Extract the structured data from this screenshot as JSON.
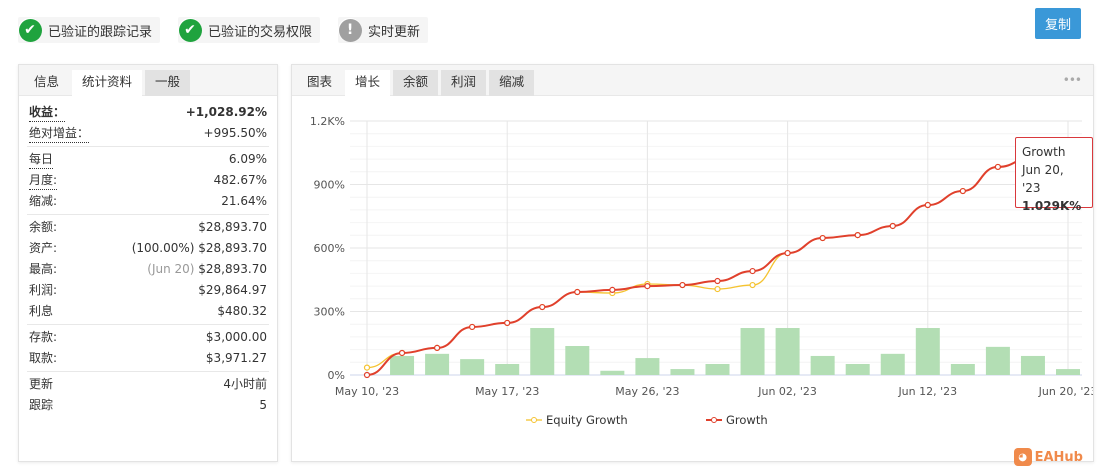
{
  "badges": [
    {
      "label": "已验证的跟踪记录",
      "icon": "check-icon",
      "color": "#1fa33e"
    },
    {
      "label": "已验证的交易权限",
      "icon": "check-icon",
      "color": "#1fa33e"
    },
    {
      "label": "实时更新",
      "icon": "exclamation-icon",
      "color": "#a0a0a0"
    }
  ],
  "copy_label": "复制",
  "left_tabs": [
    "信息",
    "统计资料",
    "一般"
  ],
  "stats": [
    [
      {
        "k": "收益：",
        "v": "+1,028.92%",
        "cls": "green bold",
        "kcls": "dot bold"
      },
      {
        "k": "绝对增益：",
        "v": "+995.50%",
        "cls": "green",
        "kcls": "dot"
      }
    ],
    [
      {
        "k": "每日",
        "v": "6.09%",
        "kcls": "dot"
      },
      {
        "k": "月度:",
        "v": "482.67%",
        "kcls": "dot"
      },
      {
        "k": "缩减:",
        "v": "21.64%"
      }
    ],
    [
      {
        "k": "余额:",
        "v": "$28,893.70"
      },
      {
        "k": "资产:",
        "v": "$28,893.70",
        "pre": "(100.00%) "
      },
      {
        "k": "最高:",
        "v": "$28,893.70",
        "pre": "(Jun 20) ",
        "precls": "muted"
      },
      {
        "k": "利润:",
        "v": "$29,864.97",
        "cls": "green"
      },
      {
        "k": "利息",
        "v": "$480.32"
      }
    ],
    [
      {
        "k": "存款:",
        "v": "$3,000.00"
      },
      {
        "k": "取款:",
        "v": "$3,971.27"
      }
    ],
    [
      {
        "k": "更新",
        "v": "4小时前"
      },
      {
        "k": "跟踪",
        "v": "5"
      }
    ]
  ],
  "chart_tabs": [
    "图表",
    "增长",
    "余额",
    "利润",
    "缩减"
  ],
  "more_label": "•••",
  "tooltip": {
    "series": "Growth",
    "date": "Jun 20, '23",
    "value": "1.029K%"
  },
  "logo": "EAHub",
  "chart_data": {
    "type": "line",
    "ylim": [
      0,
      1200
    ],
    "yticks": [
      "0%",
      "300%",
      "600%",
      "900%",
      "1.2K%"
    ],
    "ytick_values": [
      0,
      300,
      600,
      900,
      1200
    ],
    "xticks": [
      {
        "i": 0,
        "label": "May 10, '23"
      },
      {
        "i": 4,
        "label": "May 17, '23"
      },
      {
        "i": 8,
        "label": "May 26, '23"
      },
      {
        "i": 12,
        "label": "Jun 02, '23"
      },
      {
        "i": 16,
        "label": "Jun 12, '23"
      },
      {
        "i": 20,
        "label": "Jun 20, '23"
      }
    ],
    "series": [
      {
        "name": "Equity Growth",
        "color": "#f5c330",
        "values": [
          35,
          104,
          128,
          227,
          246,
          321,
          392,
          387,
          430,
          425,
          406,
          425,
          576,
          647,
          661,
          704,
          803,
          869,
          983,
          1030,
          1029
        ]
      },
      {
        "name": "Growth",
        "color": "#e0402c",
        "values": [
          0,
          104,
          128,
          227,
          246,
          321,
          392,
          402,
          420,
          425,
          444,
          491,
          576,
          647,
          661,
          704,
          803,
          869,
          983,
          1030,
          1029
        ]
      },
      {
        "name": "bars",
        "color": "#b3deb4",
        "values": [
          null,
          90,
          100,
          75,
          52,
          222,
          137,
          20,
          80,
          28,
          52,
          222,
          222,
          90,
          52,
          100,
          222,
          52,
          133,
          90,
          28
        ]
      }
    ]
  }
}
